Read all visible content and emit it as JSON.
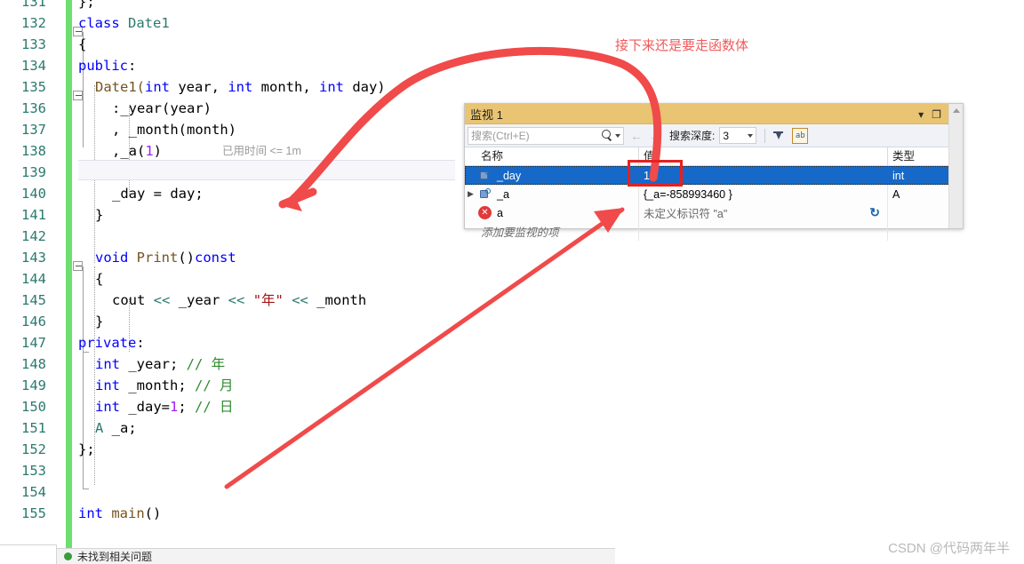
{
  "editor": {
    "first_line": 131,
    "lines": [
      {
        "num": 131,
        "indent": 0,
        "tokens": [
          {
            "t": "};",
            "c": "pl"
          }
        ]
      },
      {
        "num": 132,
        "indent": 0,
        "tokens": [
          {
            "t": "class ",
            "c": "k"
          },
          {
            "t": "Date1",
            "c": "ty"
          }
        ]
      },
      {
        "num": 133,
        "indent": 0,
        "tokens": [
          {
            "t": "{",
            "c": "pl"
          }
        ]
      },
      {
        "num": 134,
        "indent": 0,
        "tokens": [
          {
            "t": "public",
            "c": "k"
          },
          {
            "t": ":",
            "c": "pl"
          }
        ]
      },
      {
        "num": 135,
        "indent": 1,
        "tokens": [
          {
            "t": "Date1(",
            "c": "fn"
          },
          {
            "t": "int",
            "c": "k"
          },
          {
            "t": " year, ",
            "c": "pl"
          },
          {
            "t": "int",
            "c": "k"
          },
          {
            "t": " month, ",
            "c": "pl"
          },
          {
            "t": "int",
            "c": "k"
          },
          {
            "t": " day)",
            "c": "pl"
          }
        ]
      },
      {
        "num": 136,
        "indent": 2,
        "tokens": [
          {
            "t": ":_year(year)",
            "c": "pl"
          }
        ]
      },
      {
        "num": 137,
        "indent": 2,
        "tokens": [
          {
            "t": ", _month(month)",
            "c": "pl"
          }
        ]
      },
      {
        "num": 138,
        "indent": 2,
        "tokens": [
          {
            "t": ",_a(",
            "c": "pl"
          },
          {
            "t": "1",
            "c": "nu"
          },
          {
            "t": ")",
            "c": "pl"
          }
        ]
      },
      {
        "num": 139,
        "indent": 1,
        "tokens": [
          {
            "t": "{",
            "c": "pl"
          }
        ]
      },
      {
        "num": 140,
        "indent": 2,
        "tokens": [
          {
            "t": "_day = day;",
            "c": "pl"
          }
        ]
      },
      {
        "num": 141,
        "indent": 1,
        "tokens": [
          {
            "t": "}",
            "c": "pl"
          }
        ]
      },
      {
        "num": 142,
        "indent": 0,
        "tokens": []
      },
      {
        "num": 143,
        "indent": 1,
        "tokens": [
          {
            "t": "void",
            "c": "k"
          },
          {
            "t": " ",
            "c": "pl"
          },
          {
            "t": "Print",
            "c": "fn"
          },
          {
            "t": "()",
            "c": "pl"
          },
          {
            "t": "const",
            "c": "k"
          }
        ]
      },
      {
        "num": 144,
        "indent": 1,
        "tokens": [
          {
            "t": "{",
            "c": "pl"
          }
        ]
      },
      {
        "num": 145,
        "indent": 2,
        "tokens": [
          {
            "t": "cout ",
            "c": "pl"
          },
          {
            "t": "<<",
            "c": "ty"
          },
          {
            "t": " _year ",
            "c": "pl"
          },
          {
            "t": "<<",
            "c": "ty"
          },
          {
            "t": " ",
            "c": "pl"
          },
          {
            "t": "\"年\"",
            "c": "st"
          },
          {
            "t": " ",
            "c": "pl"
          },
          {
            "t": "<<",
            "c": "ty"
          },
          {
            "t": " _month",
            "c": "pl"
          }
        ]
      },
      {
        "num": 146,
        "indent": 1,
        "tokens": [
          {
            "t": "}",
            "c": "pl"
          }
        ]
      },
      {
        "num": 147,
        "indent": 0,
        "tokens": [
          {
            "t": "private",
            "c": "k"
          },
          {
            "t": ":",
            "c": "pl"
          }
        ]
      },
      {
        "num": 148,
        "indent": 1,
        "tokens": [
          {
            "t": "int",
            "c": "k"
          },
          {
            "t": " _year; ",
            "c": "pl"
          },
          {
            "t": "// 年",
            "c": "cm"
          }
        ]
      },
      {
        "num": 149,
        "indent": 1,
        "tokens": [
          {
            "t": "int",
            "c": "k"
          },
          {
            "t": " _month; ",
            "c": "pl"
          },
          {
            "t": "// 月",
            "c": "cm"
          }
        ]
      },
      {
        "num": 150,
        "indent": 1,
        "tokens": [
          {
            "t": "int",
            "c": "k"
          },
          {
            "t": " _day=",
            "c": "pl"
          },
          {
            "t": "1",
            "c": "nu"
          },
          {
            "t": "; ",
            "c": "pl"
          },
          {
            "t": "// 日",
            "c": "cm"
          }
        ]
      },
      {
        "num": 151,
        "indent": 1,
        "tokens": [
          {
            "t": "A",
            "c": "ty"
          },
          {
            "t": " _a;",
            "c": "pl"
          }
        ]
      },
      {
        "num": 152,
        "indent": 0,
        "tokens": [
          {
            "t": "};",
            "c": "pl"
          }
        ]
      },
      {
        "num": 153,
        "indent": 0,
        "tokens": []
      },
      {
        "num": 154,
        "indent": 0,
        "tokens": []
      },
      {
        "num": 155,
        "indent": 0,
        "tokens": [
          {
            "t": "int",
            "c": "k"
          },
          {
            "t": " ",
            "c": "pl"
          },
          {
            "t": "main",
            "c": "fn"
          },
          {
            "t": "()",
            "c": "pl"
          }
        ]
      }
    ],
    "codelens": {
      "line": 138,
      "text": "已用时间 <= 1m"
    }
  },
  "watch": {
    "title": "监视 1",
    "window_buttons": {
      "dropdown": "▾",
      "maximize": "❐",
      "close": "✕"
    },
    "toolbar": {
      "search_placeholder": "搜索(Ctrl+E)",
      "search_icon": "search-icon",
      "back_arrow": "←",
      "forward_arrow": "→",
      "depth_label": "搜索深度:",
      "depth_value": "3",
      "filter_icon": "filter-icon",
      "hex_icon": "hex-display-icon"
    },
    "columns": [
      "名称",
      "值",
      "类型"
    ],
    "rows": [
      {
        "name": "_day",
        "value": "1",
        "type": "int",
        "icon": "field-icon",
        "expandable": false,
        "selected": true
      },
      {
        "name": "_a",
        "value": "{_a=-858993460 }",
        "type": "A",
        "icon": "field-icon",
        "expandable": true,
        "selected": false
      },
      {
        "name": "a",
        "value": "未定义标识符 \"a\"",
        "type": "",
        "icon": "error-icon",
        "expandable": false,
        "selected": false,
        "error": true,
        "refresh": "↻"
      }
    ],
    "add_item_text": "添加要监视的项"
  },
  "annotations": {
    "note_text": "接下来还是要走函数体",
    "color": "#f05a5a",
    "box_color": "#e62020"
  },
  "statusbar": {
    "text": "未找到相关问题"
  },
  "watermark": "CSDN @代码两年半"
}
